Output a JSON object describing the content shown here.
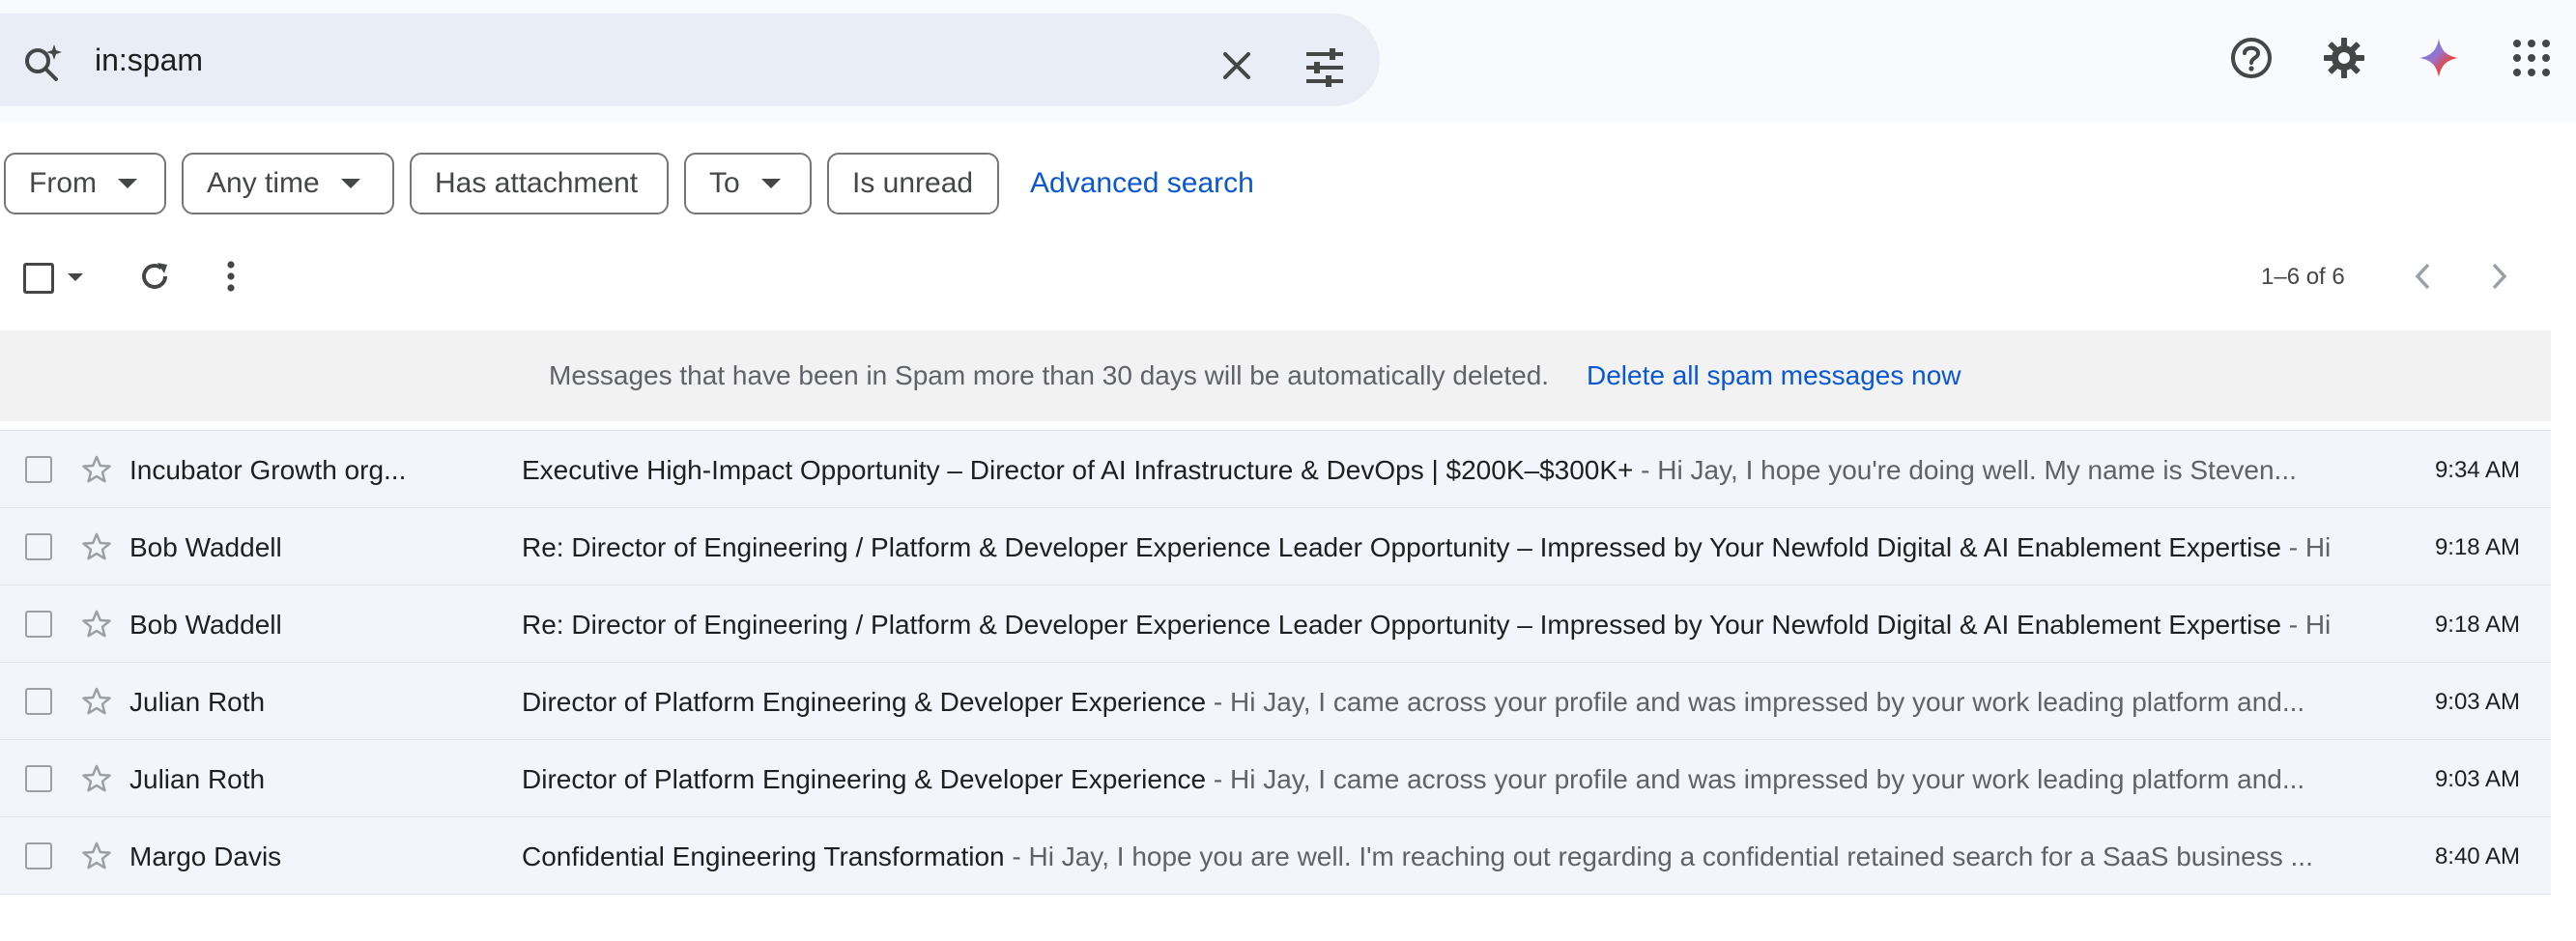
{
  "search": {
    "query": "in:spam",
    "icons": {
      "search": "search-sparkle-icon",
      "clear": "close-icon",
      "options": "tune-icon"
    }
  },
  "header_icons": [
    "help-icon",
    "gear-icon",
    "gemini-icon",
    "apps-grid-icon"
  ],
  "filters": {
    "from": "From",
    "any_time": "Any time",
    "has_attachment": "Has attachment",
    "to": "To",
    "is_unread": "Is unread",
    "advanced": "Advanced search"
  },
  "toolbar": {
    "pagination": "1–6 of 6"
  },
  "banner": {
    "message": "Messages that have been in Spam more than 30 days will be automatically deleted.",
    "action": "Delete all spam messages now"
  },
  "colors": {
    "accent": "#0b57d0",
    "row_background": "#f2f6fc",
    "banner_background": "#f2f2f2"
  },
  "emails": [
    {
      "sender": "Incubator Growth org...",
      "subject": "Executive High-Impact Opportunity – Director of AI Infrastructure & DevOps | $200K–$300K+",
      "snippet": " - Hi Jay, I hope you're doing well. My name is Steven...",
      "time": "9:34 AM"
    },
    {
      "sender": "Bob Waddell",
      "subject": "Re: Director of Engineering / Platform & Developer Experience Leader Opportunity – Impressed by Your Newfold Digital & AI Enablement Expertise",
      "snippet": " - Hi",
      "time": "9:18 AM"
    },
    {
      "sender": "Bob Waddell",
      "subject": "Re: Director of Engineering / Platform & Developer Experience Leader Opportunity – Impressed by Your Newfold Digital & AI Enablement Expertise",
      "snippet": " - Hi",
      "time": "9:18 AM"
    },
    {
      "sender": "Julian Roth",
      "subject": "Director of Platform Engineering & Developer Experience",
      "snippet": " - Hi Jay, I came across your profile and was impressed by your work leading platform and...",
      "time": "9:03 AM"
    },
    {
      "sender": "Julian Roth",
      "subject": "Director of Platform Engineering & Developer Experience",
      "snippet": " - Hi Jay, I came across your profile and was impressed by your work leading platform and...",
      "time": "9:03 AM"
    },
    {
      "sender": "Margo Davis",
      "subject": "Confidential Engineering Transformation",
      "snippet": " - Hi Jay, I hope you are well. I'm reaching out regarding a confidential retained search for a SaaS business ...",
      "time": "8:40 AM"
    }
  ]
}
